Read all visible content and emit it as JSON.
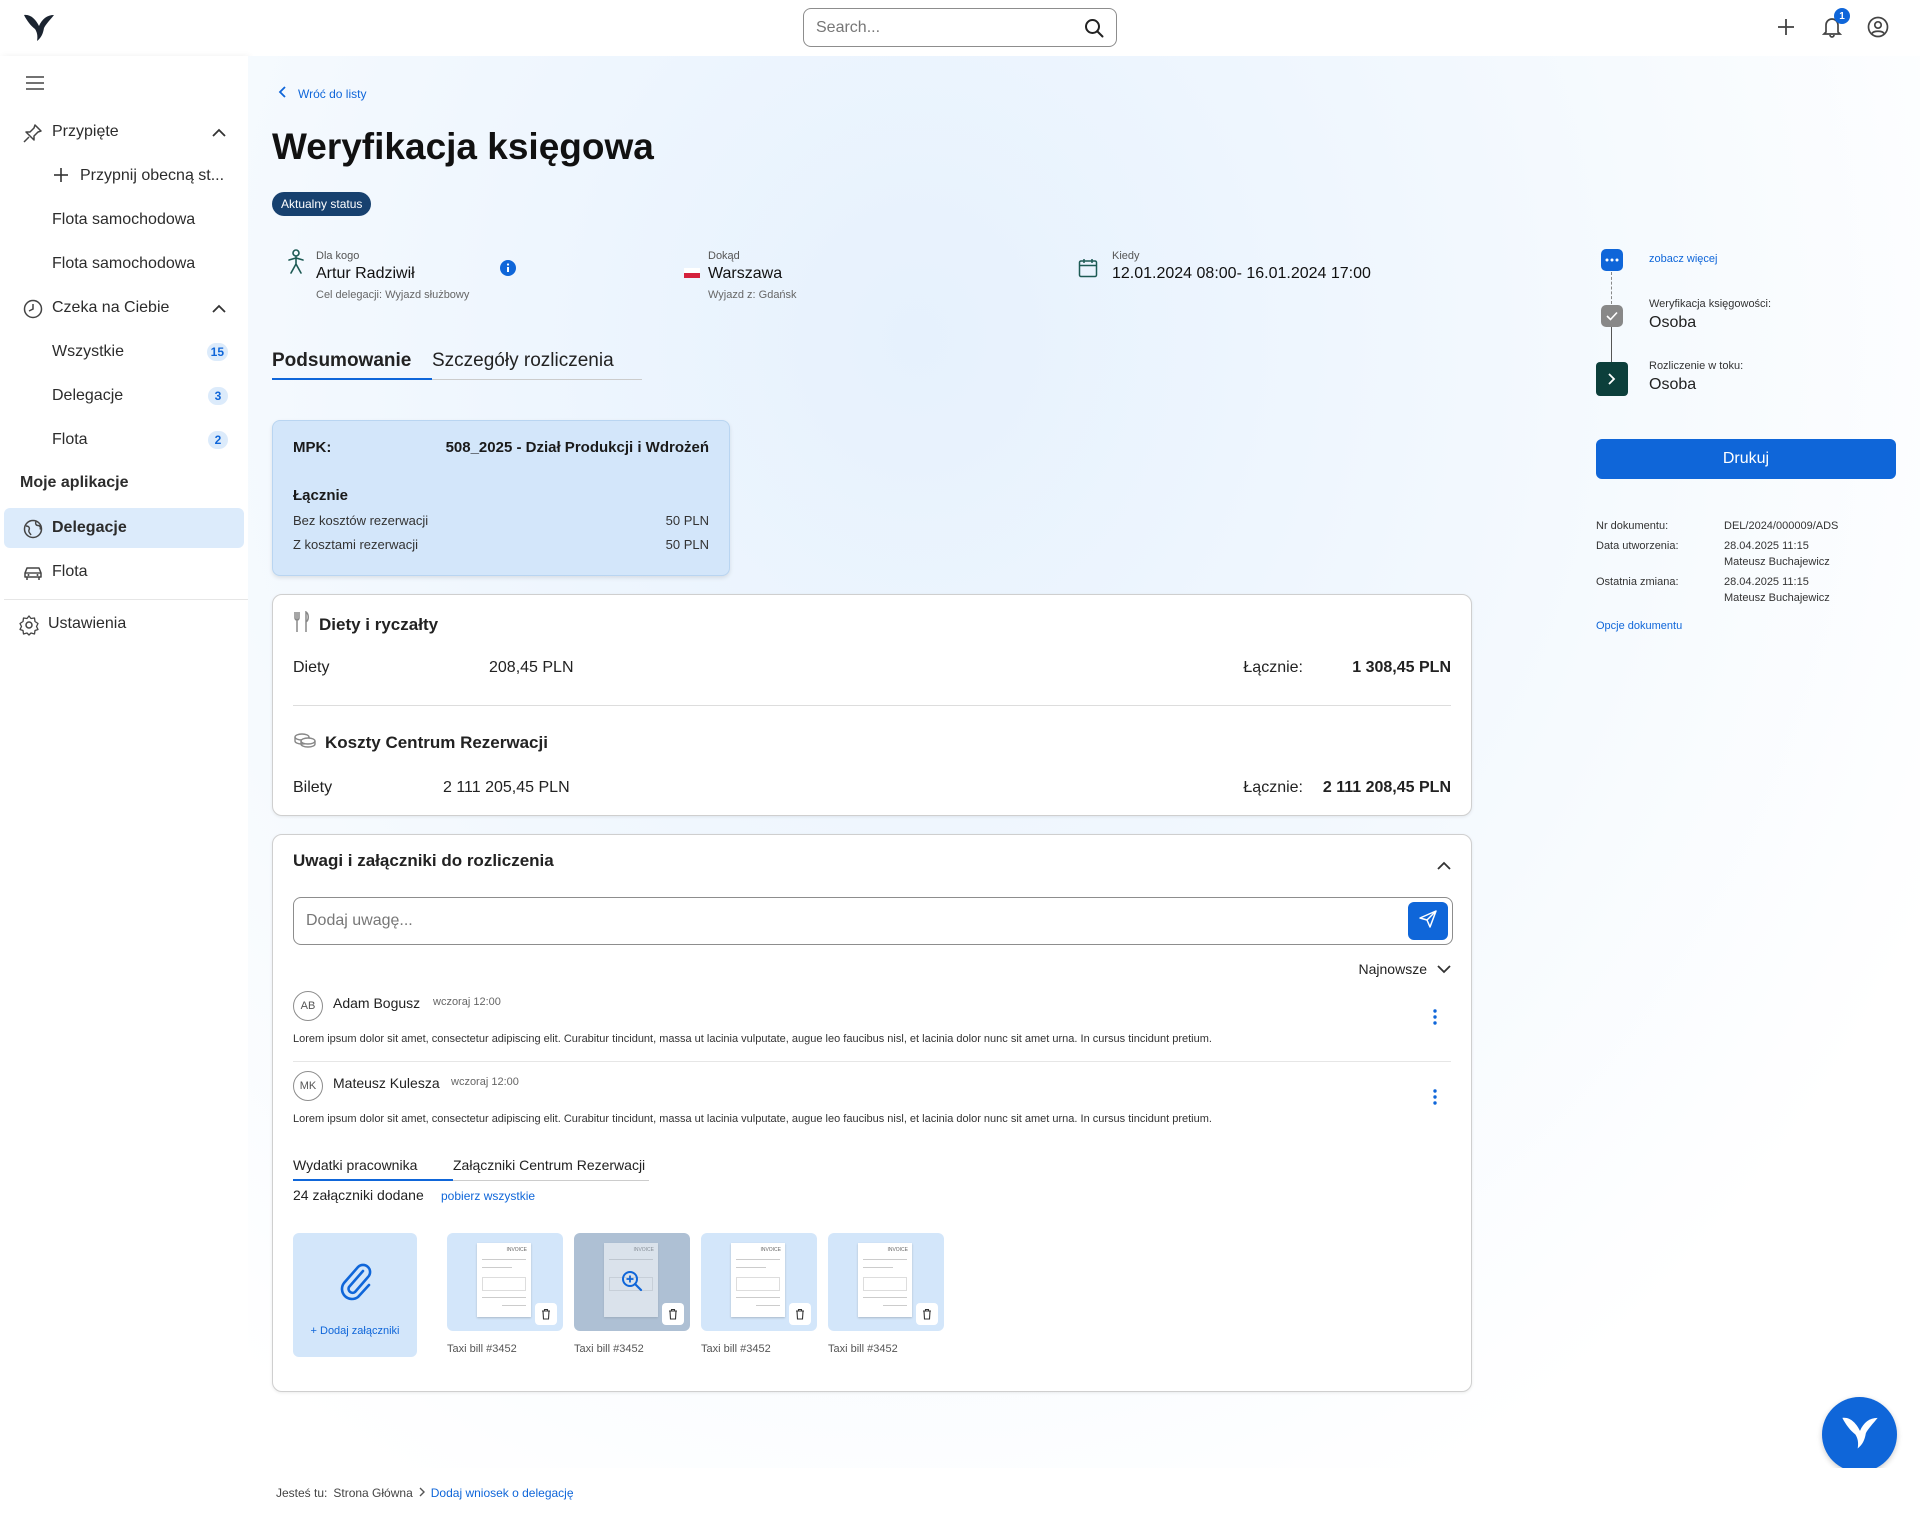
{
  "header": {
    "search_placeholder": "Search...",
    "notifications_count": "1"
  },
  "sidebar": {
    "pinned": {
      "label": "Przypięte",
      "items": [
        "Przypnij obecną st...",
        "Flota samochodowa",
        "Flota samochodowa"
      ]
    },
    "waiting": {
      "label": "Czeka na Ciebie",
      "items": [
        {
          "label": "Wszystkie",
          "count": "15"
        },
        {
          "label": "Delegacje",
          "count": "3"
        },
        {
          "label": "Flota",
          "count": "2"
        }
      ]
    },
    "apps_heading": "Moje aplikacje",
    "apps": [
      "Delegacje",
      "Flota"
    ],
    "settings": "Ustawienia"
  },
  "page": {
    "back_label": "Wróć do listy",
    "title": "Weryfikacja księgowa",
    "status": "Aktualny status",
    "for_whom": {
      "caption": "Dla kogo",
      "value": "Artur Radziwił",
      "sub_label": "Cel delegacji:",
      "sub_value": "Wyjazd służbowy"
    },
    "where": {
      "caption": "Dokąd",
      "value": "Warszawa",
      "sub_label": "Wyjazd z:",
      "sub_value": "Gdańsk"
    },
    "when": {
      "caption": "Kiedy",
      "value": "12.01.2024 08:00- 16.01.2024 17:00"
    },
    "tabs": [
      "Podsumowanie",
      "Szczegóły rozliczenia"
    ]
  },
  "mpk": {
    "label": "MPK:",
    "value": "508_2025 - Dział Produkcji i Wdrożeń",
    "total_label": "Łącznie",
    "rows": [
      {
        "label": "Bez kosztów rezerwacji",
        "value": "50 PLN"
      },
      {
        "label": "Z kosztami rezerwacji",
        "value": "50 PLN"
      }
    ]
  },
  "summary": {
    "diets": {
      "title": "Diety i ryczałty",
      "row_label": "Diety",
      "row_value": "208,45 PLN",
      "total_label": "Łącznie:",
      "total_value": "1 308,45 PLN"
    },
    "booking": {
      "title": "Koszty Centrum Rezerwacji",
      "row_label": "Bilety",
      "row_value": "2 111 205,45 PLN",
      "total_label": "Łącznie:",
      "total_value": "2 111 208,45 PLN"
    }
  },
  "notes": {
    "title": "Uwagi  i załączniki do rozliczenia",
    "input_placeholder": "Dodaj uwagę...",
    "sort_label": "Najnowsze",
    "comments": [
      {
        "initials": "AB",
        "author": "Adam Bogusz",
        "time": "wczoraj 12:00",
        "text": "Lorem ipsum dolor sit amet, consectetur adipiscing elit. Curabitur tincidunt, massa ut lacinia vulputate, augue leo faucibus nisl, et lacinia dolor nunc sit amet urna. In cursus tincidunt pretium."
      },
      {
        "initials": "MK",
        "author": "Mateusz Kulesza",
        "time": "wczoraj 12:00",
        "text": "Lorem ipsum dolor sit amet, consectetur adipiscing elit. Curabitur tincidunt, massa ut lacinia vulputate, augue leo faucibus nisl, et lacinia dolor nunc sit amet urna. In cursus tincidunt pretium."
      }
    ],
    "attachment_tabs": [
      "Wydatki pracownika",
      "Załączniki Centrum Rezerwacji"
    ],
    "attachments_count": "24 załączniki dodane",
    "download_all": "pobierz wszystkie",
    "add_attachment": "+ Dodaj załączniki",
    "files": [
      "Taxi bill #3452",
      "Taxi bill #3452",
      "Taxi bill #3452",
      "Taxi bill #3452"
    ],
    "invoice_header": "INVOICE"
  },
  "workflow": {
    "see_more": "zobacz więcej",
    "steps": [
      {
        "label": "Weryfikacja księgowości:",
        "value": "Osoba"
      },
      {
        "label": "Rozliczenie w toku:",
        "value": "Osoba"
      }
    ],
    "print_label": "Drukuj"
  },
  "doc_meta": {
    "number_label": "Nr dokumentu:",
    "number_value": "DEL/2024/000009/ADS",
    "created_label": "Data utworzenia:",
    "created_date": "28.04.2025 11:15",
    "created_by": "Mateusz Buchajewicz",
    "changed_label": "Ostatnia zmiana:",
    "changed_date": "28.04.2025 11:15",
    "changed_by": "Mateusz Buchajewicz",
    "options_label": "Opcje dokumentu"
  },
  "footer": {
    "you_are_here": "Jesteś tu:",
    "home": "Strona Główna",
    "current": "Dodaj wniosek o delegację"
  },
  "colors": {
    "accent": "#0f66d9",
    "status_pill": "#17416f",
    "card_blue": "#d3e6fa",
    "badge_bg": "#dcebfb"
  }
}
